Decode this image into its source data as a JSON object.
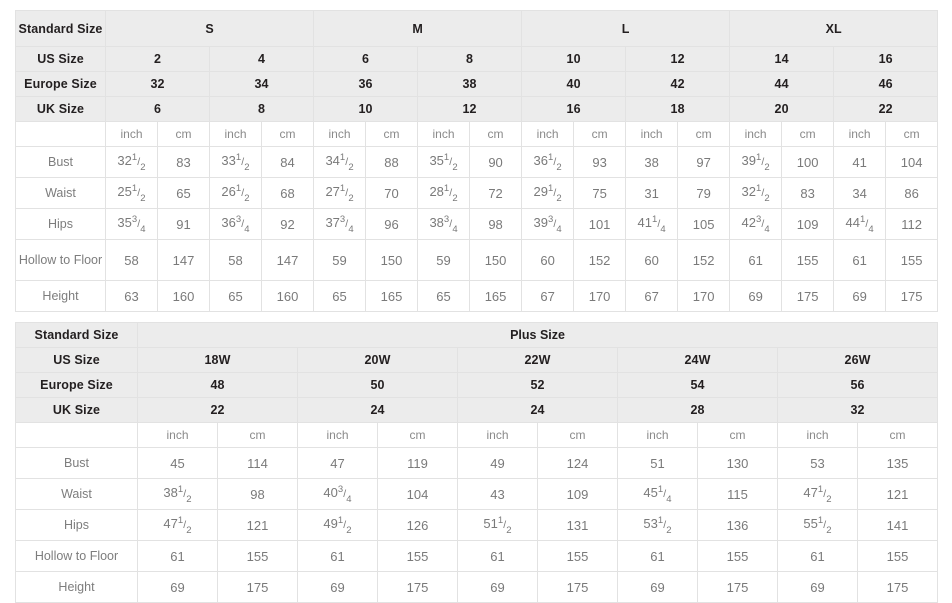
{
  "standard_table": {
    "labels": {
      "standard_size": "Standard Size",
      "us_size": "US Size",
      "europe_size": "Europe Size",
      "uk_size": "UK Size"
    },
    "size_groups": [
      {
        "name": "S",
        "span": 4
      },
      {
        "name": "M",
        "span": 4
      },
      {
        "name": "L",
        "span": 4
      },
      {
        "name": "XL",
        "span": 4
      }
    ],
    "us_sizes": [
      "2",
      "4",
      "6",
      "8",
      "10",
      "12",
      "14",
      "16"
    ],
    "europe_sizes": [
      "32",
      "34",
      "36",
      "38",
      "40",
      "42",
      "44",
      "46"
    ],
    "uk_sizes": [
      "6",
      "8",
      "10",
      "12",
      "16",
      "18",
      "20",
      "22"
    ],
    "units": [
      "inch",
      "cm",
      "inch",
      "cm",
      "inch",
      "cm",
      "inch",
      "cm",
      "inch",
      "cm",
      "inch",
      "cm",
      "inch",
      "cm",
      "inch",
      "cm"
    ],
    "measurements": [
      {
        "label": "Bust",
        "values": [
          "32 1/2",
          "83",
          "33 1/2",
          "84",
          "34 1/2",
          "88",
          "35 1/2",
          "90",
          "36 1/2",
          "93",
          "38",
          "97",
          "39 1/2",
          "100",
          "41",
          "104"
        ]
      },
      {
        "label": "Waist",
        "values": [
          "25 1/2",
          "65",
          "26 1/2",
          "68",
          "27 1/2",
          "70",
          "28 1/2",
          "72",
          "29 1/2",
          "75",
          "31",
          "79",
          "32 1/2",
          "83",
          "34",
          "86"
        ]
      },
      {
        "label": "Hips",
        "values": [
          "35 3/4",
          "91",
          "36 3/4",
          "92",
          "37 3/4",
          "96",
          "38 3/4",
          "98",
          "39 3/4",
          "101",
          "41 1/4",
          "105",
          "42 3/4",
          "109",
          "44 1/4",
          "112"
        ]
      },
      {
        "label": "Hollow to Floor",
        "values": [
          "58",
          "147",
          "58",
          "147",
          "59",
          "150",
          "59",
          "150",
          "60",
          "152",
          "60",
          "152",
          "61",
          "155",
          "61",
          "155"
        ]
      },
      {
        "label": "Height",
        "values": [
          "63",
          "160",
          "65",
          "160",
          "65",
          "165",
          "65",
          "165",
          "67",
          "170",
          "67",
          "170",
          "69",
          "175",
          "69",
          "175"
        ]
      }
    ]
  },
  "plus_table": {
    "labels": {
      "standard_size": "Standard Size",
      "plus_size": "Plus Size",
      "us_size": "US Size",
      "europe_size": "Europe Size",
      "uk_size": "UK Size"
    },
    "us_sizes": [
      "18W",
      "20W",
      "22W",
      "24W",
      "26W"
    ],
    "europe_sizes": [
      "48",
      "50",
      "52",
      "54",
      "56"
    ],
    "uk_sizes": [
      "22",
      "24",
      "24",
      "28",
      "32"
    ],
    "units": [
      "inch",
      "cm",
      "inch",
      "cm",
      "inch",
      "cm",
      "inch",
      "cm",
      "inch",
      "cm"
    ],
    "measurements": [
      {
        "label": "Bust",
        "values": [
          "45",
          "114",
          "47",
          "119",
          "49",
          "124",
          "51",
          "130",
          "53",
          "135"
        ]
      },
      {
        "label": "Waist",
        "values": [
          "38 1/2",
          "98",
          "40 3/4",
          "104",
          "43",
          "109",
          "45 1/4",
          "115",
          "47 1/2",
          "121"
        ]
      },
      {
        "label": "Hips",
        "values": [
          "47 1/2",
          "121",
          "49 1/2",
          "126",
          "51 1/2",
          "131",
          "53 1/2",
          "136",
          "55 1/2",
          "141"
        ]
      },
      {
        "label": "Hollow to Floor",
        "values": [
          "61",
          "155",
          "61",
          "155",
          "61",
          "155",
          "61",
          "155",
          "61",
          "155"
        ]
      },
      {
        "label": "Height",
        "values": [
          "69",
          "175",
          "69",
          "175",
          "69",
          "175",
          "69",
          "175",
          "69",
          "175"
        ]
      }
    ]
  },
  "colors": {
    "header_bg": "#ececec",
    "header_text": "#231f20",
    "value_text": "#7a7a7a",
    "border": "#e2e2e2",
    "page_bg": "#ffffff"
  }
}
